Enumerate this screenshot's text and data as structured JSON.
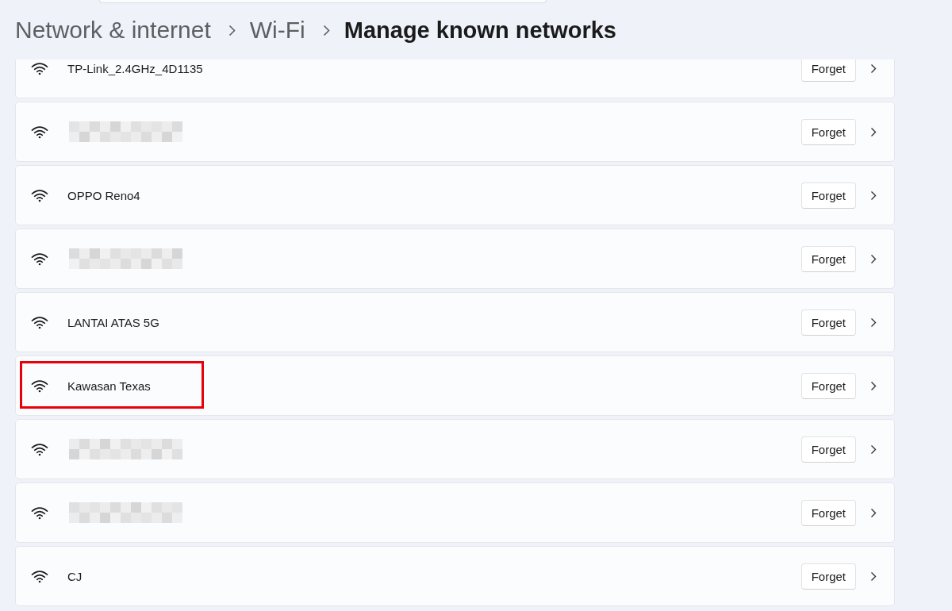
{
  "breadcrumb": [
    {
      "label": "Network & internet",
      "current": false
    },
    {
      "label": "Wi-Fi",
      "current": false
    },
    {
      "label": "Manage known networks",
      "current": true
    }
  ],
  "networks": [
    {
      "kind": "named",
      "name": "TP-Link_2.4GHz_4D1135",
      "button": "Forget",
      "highlighted": false
    },
    {
      "kind": "redacted",
      "button": "Forget",
      "highlighted": false
    },
    {
      "kind": "named",
      "name": "OPPO Reno4",
      "button": "Forget",
      "highlighted": false
    },
    {
      "kind": "redacted",
      "button": "Forget",
      "highlighted": false
    },
    {
      "kind": "named",
      "name": "LANTAI ATAS 5G",
      "button": "Forget",
      "highlighted": false
    },
    {
      "kind": "named",
      "name": "Kawasan Texas",
      "button": "Forget",
      "highlighted": true
    },
    {
      "kind": "redacted",
      "button": "Forget",
      "highlighted": false
    },
    {
      "kind": "redacted",
      "button": "Forget",
      "highlighted": false
    },
    {
      "kind": "named",
      "name": "CJ",
      "button": "Forget",
      "highlighted": false
    }
  ]
}
